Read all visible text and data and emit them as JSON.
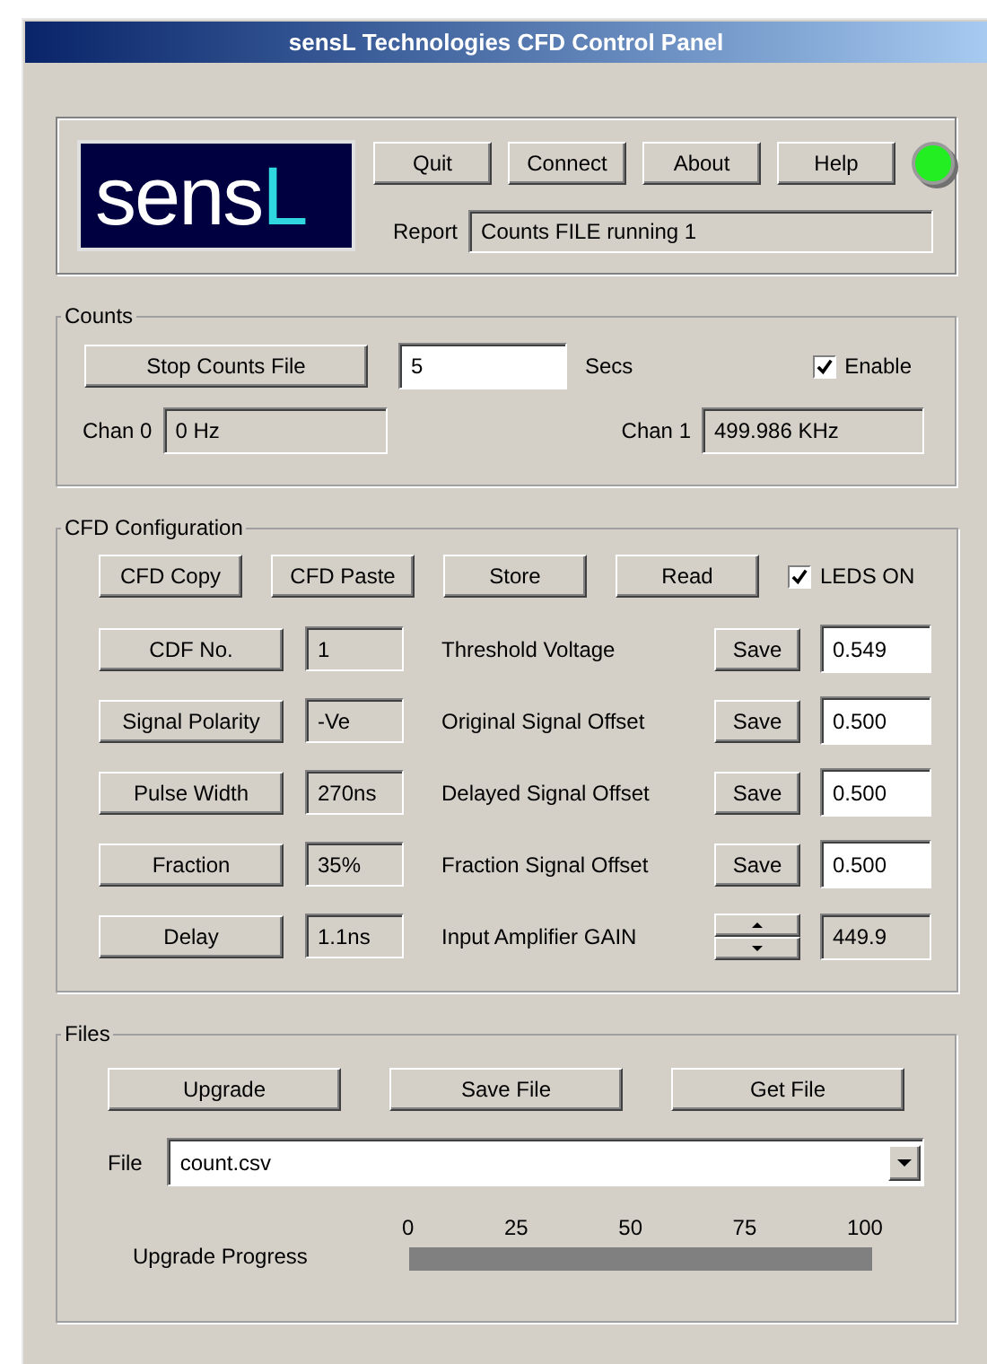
{
  "window": {
    "title": "sensL Technologies CFD Control Panel"
  },
  "header": {
    "logo": {
      "text": "sens",
      "accent": "L"
    },
    "buttons": [
      "Quit",
      "Connect",
      "About",
      "Help"
    ],
    "led": {
      "on": true
    },
    "report": {
      "label": "Report",
      "value": "Counts FILE running 1"
    }
  },
  "counts": {
    "title": "Counts",
    "button": "Stop Counts File",
    "seconds": {
      "value": "5",
      "unit": "Secs"
    },
    "enable": {
      "label": "Enable",
      "checked": true
    },
    "channels": [
      {
        "label": "Chan 0",
        "value": "0 Hz"
      },
      {
        "label": "Chan 1",
        "value": "499.986 KHz"
      }
    ]
  },
  "cfd": {
    "title": "CFD Configuration",
    "buttons": [
      "CFD Copy",
      "CFD Paste",
      "Store",
      "Read"
    ],
    "leds": {
      "label": "LEDS ON",
      "checked": true
    },
    "rows": [
      {
        "button": "CDF No.",
        "value": "1",
        "label": "Threshold Voltage",
        "kind": "save",
        "action": "Save",
        "setting": "0.549"
      },
      {
        "button": "Signal Polarity",
        "value": "-Ve",
        "label": "Original Signal Offset",
        "kind": "save",
        "action": "Save",
        "setting": "0.500"
      },
      {
        "button": "Pulse Width",
        "value": "270ns",
        "label": "Delayed Signal Offset",
        "kind": "save",
        "action": "Save",
        "setting": "0.500"
      },
      {
        "button": "Fraction",
        "value": "35%",
        "label": "Fraction Signal Offset",
        "kind": "save",
        "action": "Save",
        "setting": "0.500"
      },
      {
        "button": "Delay",
        "value": "1.1ns",
        "label": "Input Amplifier GAIN",
        "kind": "spinner",
        "setting": "449.9"
      }
    ]
  },
  "files": {
    "title": "Files",
    "buttons": [
      "Upgrade",
      "Save File",
      "Get File"
    ],
    "file": {
      "label": "File",
      "value": "count.csv"
    },
    "progress": {
      "label": "Upgrade Progress",
      "ticks": [
        "0",
        "25",
        "50",
        "75",
        "100"
      ]
    }
  }
}
